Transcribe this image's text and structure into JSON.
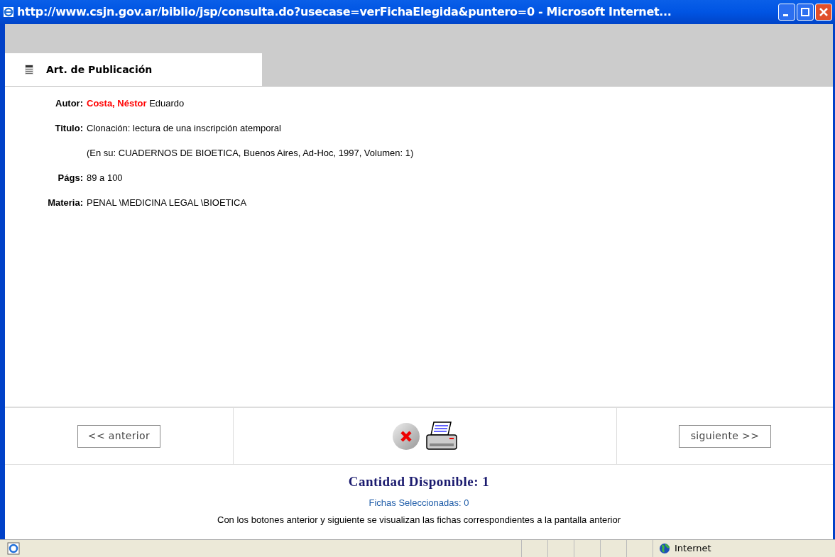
{
  "window": {
    "title": "http://www.csjn.gov.ar/biblio/jsp/consulta.do?usecase=verFichaElegida&puntero=0 - Microsoft Internet..."
  },
  "tab": {
    "label": "Art. de Publicación"
  },
  "fields": [
    {
      "kind": "author",
      "label": "Autor:",
      "highlight": "Costa, Néstor",
      "value": "Eduardo"
    },
    {
      "kind": "text",
      "label": "Titulo:",
      "value": "Clonación: lectura de una inscripción atemporal"
    },
    {
      "kind": "text",
      "value": "(En su: CUADERNOS DE BIOETICA, Buenos Aires, Ad-Hoc, 1997, Volumen: 1)"
    },
    {
      "kind": "text",
      "label": "Págs:",
      "value": "89 a 100"
    },
    {
      "kind": "text",
      "label": "Materia:",
      "value": "PENAL \\MEDICINA LEGAL \\BIOETICA"
    }
  ],
  "nav": {
    "previous": "<< anterior",
    "next": "siguiente >>"
  },
  "available": "Cantidad Disponible: 1",
  "selected_count": "Fichas Seleccionadas: 0",
  "help": "Con los botones anterior y siguiente se visualizan las fichas correspondientes a la pantalla anterior",
  "status_bar": {
    "zone": "Internet"
  }
}
